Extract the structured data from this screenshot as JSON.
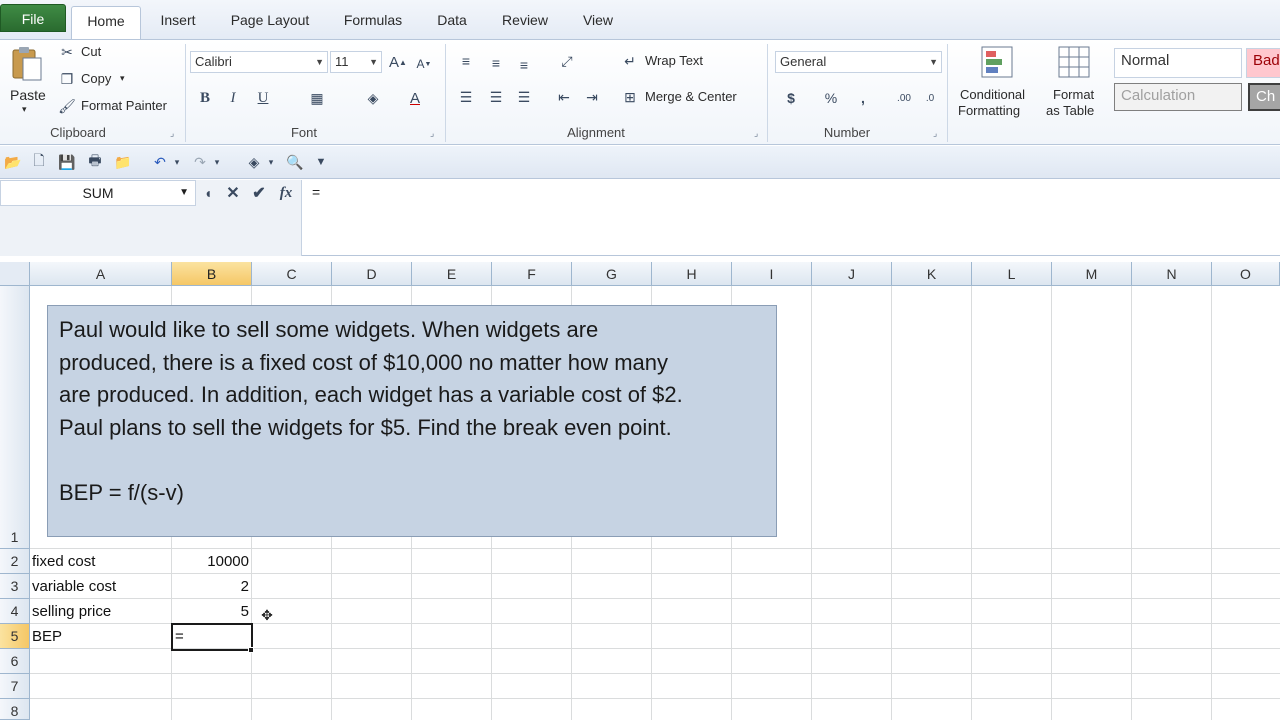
{
  "ribbon_tabs": [
    "File",
    "Home",
    "Insert",
    "Page Layout",
    "Formulas",
    "Data",
    "Review",
    "View"
  ],
  "clipboard": {
    "paste": "Paste",
    "cut": "Cut",
    "copy": "Copy",
    "format_painter": "Format Painter",
    "label": "Clipboard"
  },
  "font": {
    "name": "Calibri",
    "size": "11",
    "label": "Font",
    "bold": "B",
    "italic": "I",
    "underline": "U"
  },
  "alignment": {
    "wrap_text": "Wrap Text",
    "merge_center": "Merge & Center",
    "label": "Alignment"
  },
  "number": {
    "format": "General",
    "currency": "$",
    "percent": "%",
    "comma": ",",
    "label": "Number"
  },
  "styles": {
    "conditional_1": "Conditional",
    "conditional_2": "Formatting",
    "format_table_1": "Format",
    "format_table_2": "as Table",
    "normal": "Normal",
    "bad": "Bad",
    "calculation": "Calculation",
    "check": "Ch"
  },
  "formula_bar": {
    "name_box": "SUM",
    "fx": "fx",
    "content": "="
  },
  "columns": [
    "A",
    "B",
    "C",
    "D",
    "E",
    "F",
    "G",
    "H",
    "I",
    "J",
    "K",
    "L",
    "M",
    "N",
    "O"
  ],
  "rows": [
    "1",
    "2",
    "3",
    "4",
    "5",
    "6",
    "7",
    "8"
  ],
  "problem_text": {
    "line1": "Paul would like to sell some widgets. When widgets are",
    "line2": "produced, there is a fixed cost of $10,000 no matter how many",
    "line3": "are produced. In addition, each widget has a variable cost of $2.",
    "line4": "Paul plans to sell the widgets for $5. Find the break even point.",
    "formula": "BEP = f/(s-v)"
  },
  "cells": {
    "a2": "fixed cost",
    "b2": "10000",
    "a3": "variable cost",
    "b3": "2",
    "a4": "selling price",
    "b4": "5",
    "a5": "BEP",
    "b5": "="
  },
  "colors": {
    "accent_selected": "#f5c766",
    "file_tab": "#2a6b2f",
    "textbox_fill": "#c6d3e3"
  }
}
